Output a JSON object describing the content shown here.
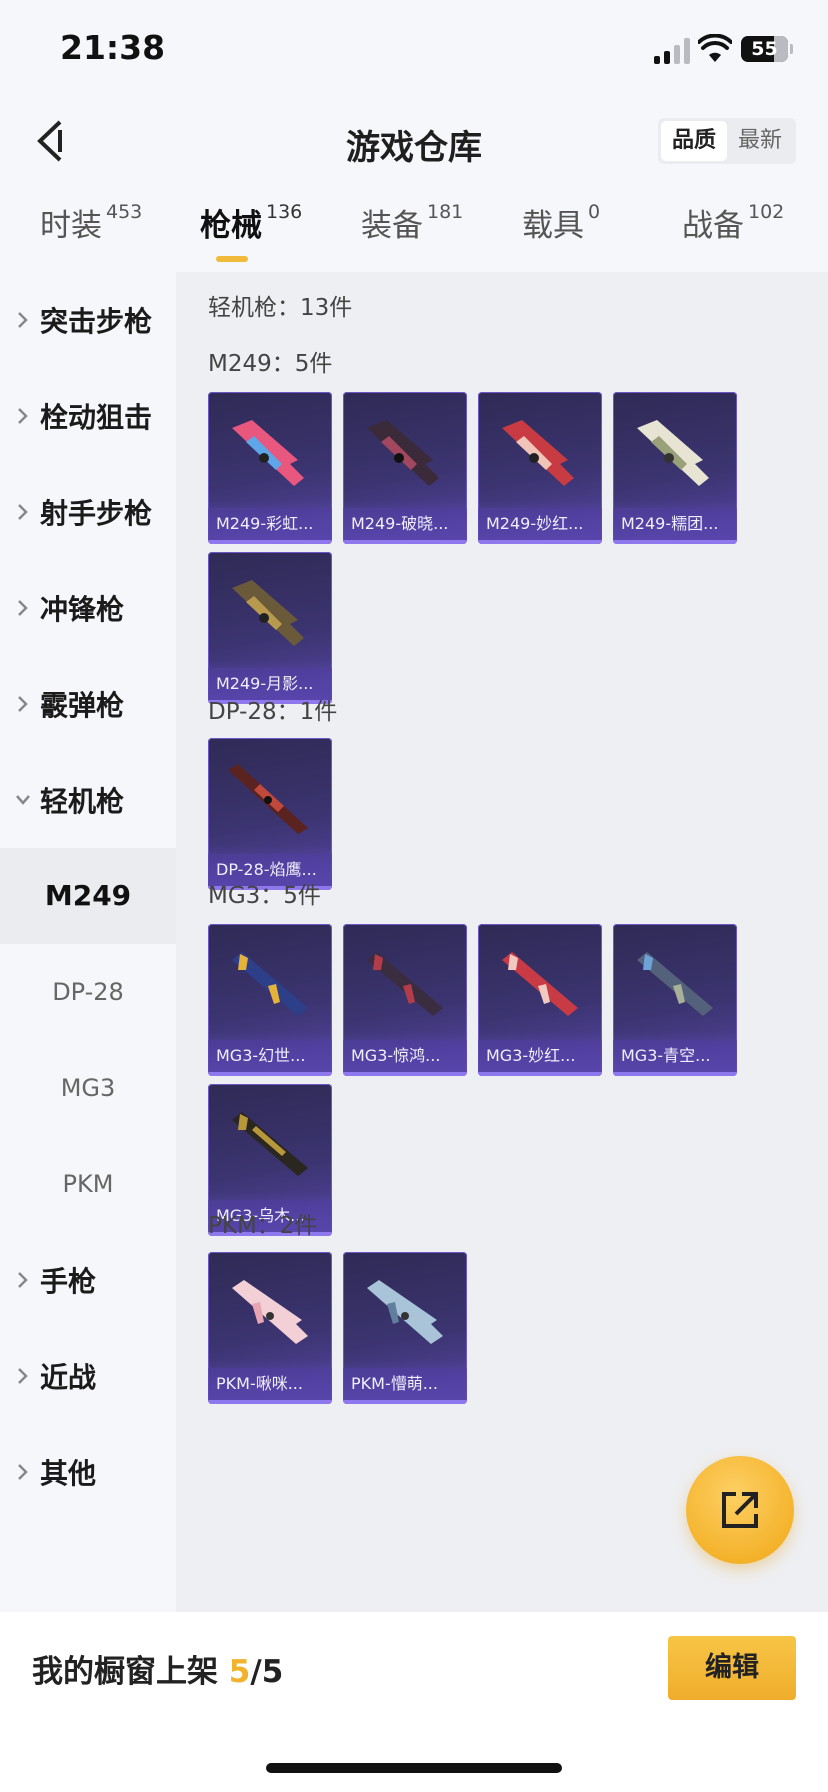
{
  "status_bar": {
    "time": "21:38",
    "battery": "55"
  },
  "header": {
    "title": "游戏仓库",
    "sort": [
      "品质",
      "最新"
    ],
    "sort_active": 0
  },
  "tabs": [
    {
      "label": "时装",
      "count": "453"
    },
    {
      "label": "枪械",
      "count": "136"
    },
    {
      "label": "装备",
      "count": "181"
    },
    {
      "label": "载具",
      "count": "0"
    },
    {
      "label": "战备",
      "count": "102"
    }
  ],
  "sidebar": {
    "categories": [
      "突击步枪",
      "栓动狙击",
      "射手步枪",
      "冲锋枪",
      "霰弹枪",
      "轻机枪"
    ],
    "expanded": "轻机枪",
    "sub_items": [
      "M249",
      "DP-28",
      "MG3",
      "PKM"
    ],
    "active_sub": "M249",
    "more": [
      "手枪",
      "近战",
      "其他"
    ]
  },
  "content": {
    "summary": "轻机枪：13件",
    "groups": [
      {
        "title": "M249：5件",
        "items": [
          "M249-彩虹...",
          "M249-破晓...",
          "M249-妙红...",
          "M249-糯团...",
          "M249-月影..."
        ]
      },
      {
        "title": "DP-28：1件",
        "items": [
          "DP-28-焰鹰..."
        ]
      },
      {
        "title": "MG3：5件",
        "items": [
          "MG3-幻世...",
          "MG3-惊鸿...",
          "MG3-妙红...",
          "MG3-青空...",
          "MG3-乌木..."
        ]
      },
      {
        "title": "PKM：2件",
        "items": [
          "PKM-啾咪...",
          "PKM-懵萌..."
        ]
      }
    ]
  },
  "bottom_bar": {
    "showcase_label": "我的橱窗上架",
    "shelf_used": "5",
    "shelf_total": "/5",
    "edit_label": "编辑"
  },
  "colors": {
    "accent": "#f1b22c",
    "card_purple": "#3b3470"
  }
}
